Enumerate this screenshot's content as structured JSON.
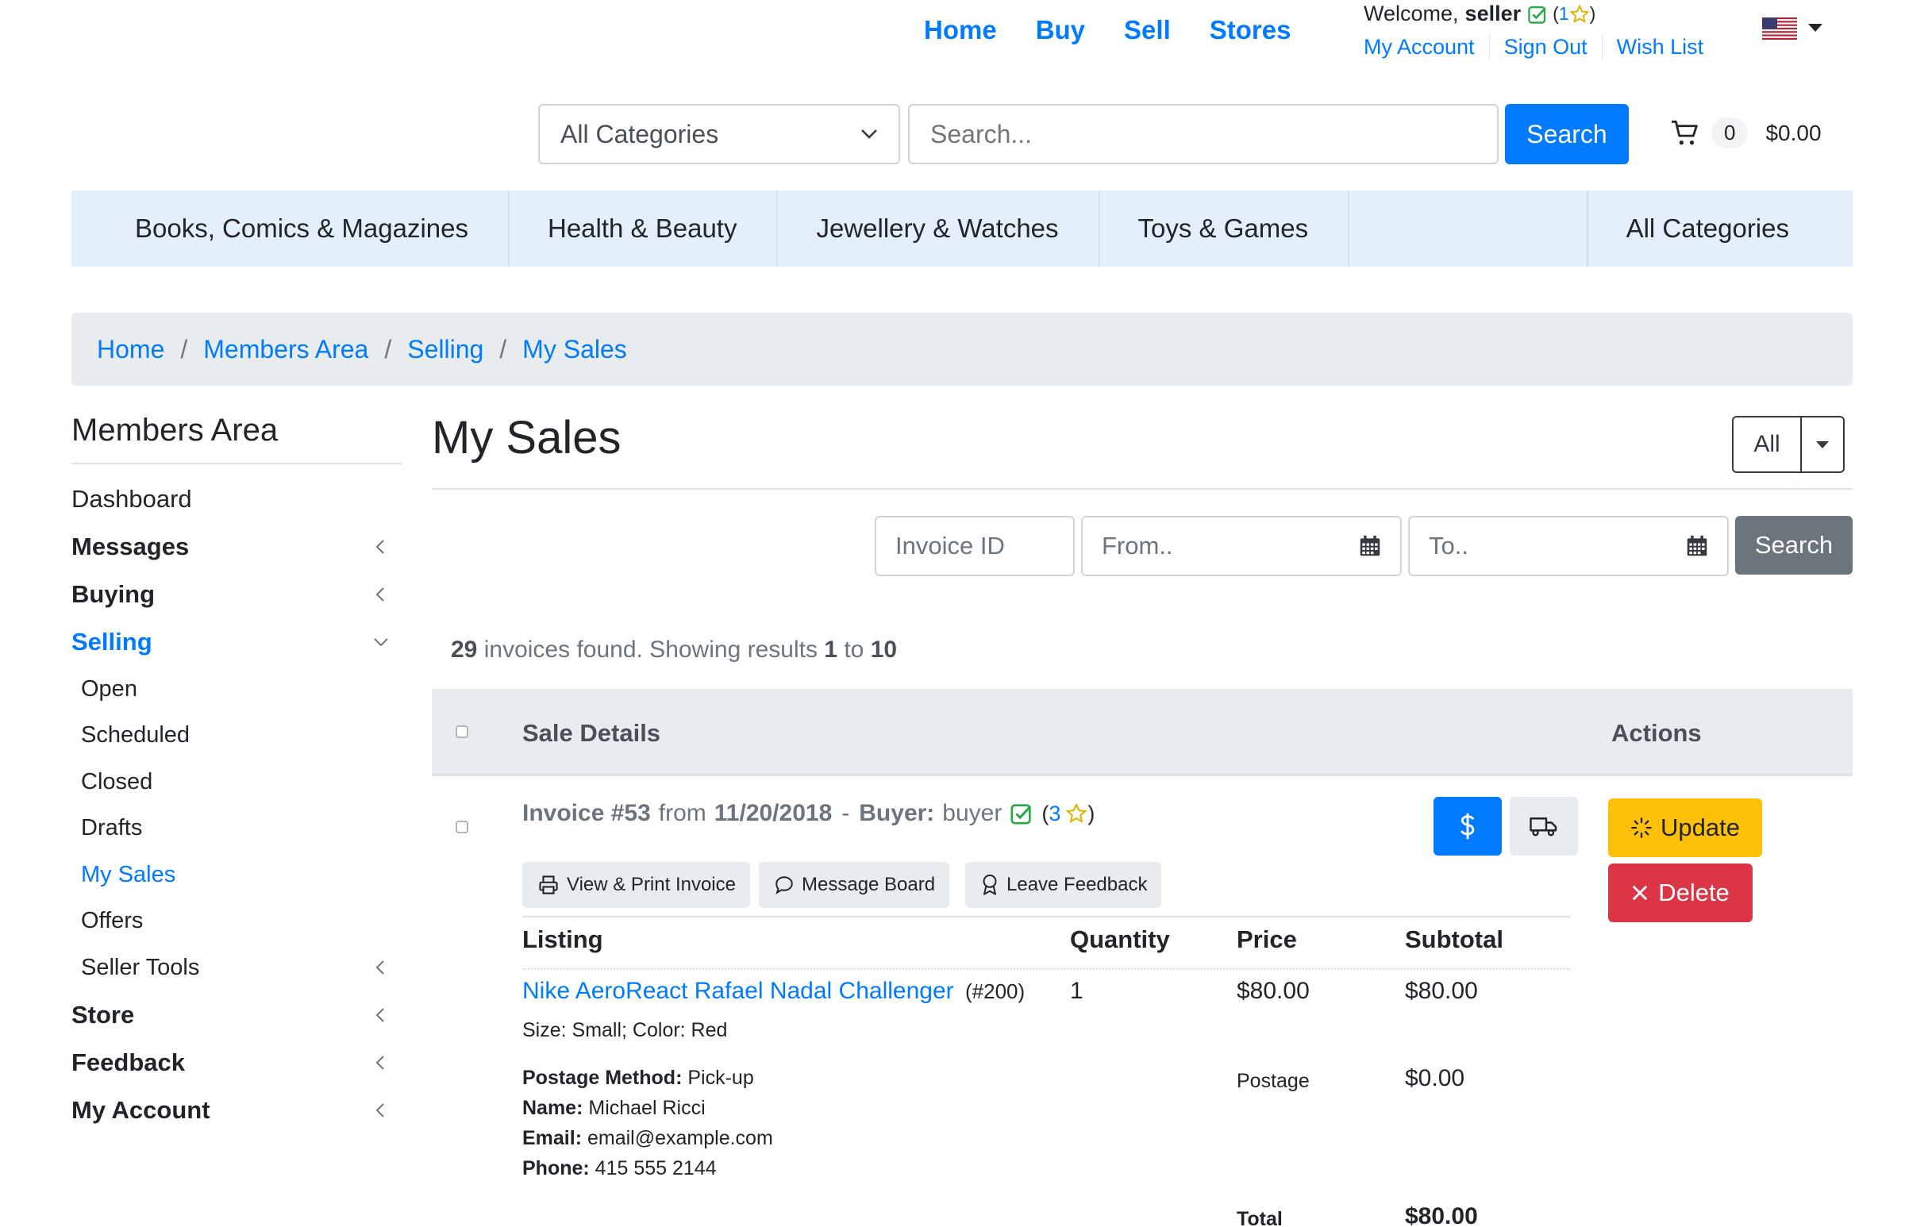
{
  "topnav": {
    "home": "Home",
    "buy": "Buy",
    "sell": "Sell",
    "stores": "Stores"
  },
  "welcome": {
    "prefix": "Welcome,",
    "user": "seller",
    "rating_open": "(",
    "rating": "1",
    "rating_close": ")"
  },
  "account_links": {
    "my_account": "My Account",
    "sign_out": "Sign Out",
    "wish_list": "Wish List"
  },
  "search": {
    "category": "All Categories",
    "placeholder": "Search...",
    "button": "Search"
  },
  "cart": {
    "count": "0",
    "total": "$0.00"
  },
  "categories": [
    "Books, Comics & Magazines",
    "Health & Beauty",
    "Jewellery & Watches",
    "Toys & Games",
    "All Categories"
  ],
  "breadcrumb": [
    "Home",
    "Members Area",
    "Selling",
    "My Sales"
  ],
  "sidebar": {
    "title": "Members Area",
    "items": [
      {
        "label": "Dashboard"
      },
      {
        "label": "Messages"
      },
      {
        "label": "Buying"
      },
      {
        "label": "Selling"
      },
      {
        "label": "Store"
      },
      {
        "label": "Feedback"
      },
      {
        "label": "My Account"
      }
    ],
    "selling_sub": [
      "Open",
      "Scheduled",
      "Closed",
      "Drafts",
      "My Sales",
      "Offers",
      "Seller Tools"
    ]
  },
  "page": {
    "title": "My Sales",
    "filter": "All"
  },
  "filters": {
    "invoice_placeholder": "Invoice ID",
    "from_placeholder": "From..",
    "to_placeholder": "To..",
    "button": "Search"
  },
  "results": {
    "total": "29",
    "text1": "invoices found. Showing results",
    "from": "1",
    "to_word": "to",
    "to": "10"
  },
  "table": {
    "col_details": "Sale Details",
    "col_actions": "Actions"
  },
  "invoice": {
    "label": "Invoice #53",
    "from_word": "from",
    "date": "11/20/2018",
    "dash": "-",
    "buyer_label": "Buyer:",
    "buyer": "buyer",
    "rating_open": "(",
    "rating": "3",
    "rating_close": ")",
    "buttons": {
      "view_print": "View & Print Invoice",
      "message_board": "Message Board",
      "leave_feedback": "Leave Feedback"
    },
    "actions": {
      "update": "Update",
      "delete": "Delete"
    },
    "columns": {
      "listing": "Listing",
      "quantity": "Quantity",
      "price": "Price",
      "subtotal": "Subtotal"
    },
    "item": {
      "name": "Nike AeroReact Rafael Nadal Challenger",
      "id": "(#200)",
      "quantity": "1",
      "price": "$80.00",
      "subtotal": "$80.00",
      "variation": "Size: Small; Color: Red"
    },
    "postage": {
      "method_label": "Postage Method:",
      "method": "Pick-up",
      "name_label": "Name:",
      "name": "Michael Ricci",
      "email_label": "Email:",
      "email": "email@example.com",
      "phone_label": "Phone:",
      "phone": "415 555 2144",
      "row_label": "Postage",
      "amount": "$0.00"
    },
    "total_label": "Total",
    "total": "$80.00"
  },
  "colors": {
    "primary": "#007bff",
    "warning": "#ffc107",
    "danger": "#dc3545",
    "secondary": "#6c757d",
    "success": "#28a745",
    "catbar": "#e3f0fc"
  }
}
